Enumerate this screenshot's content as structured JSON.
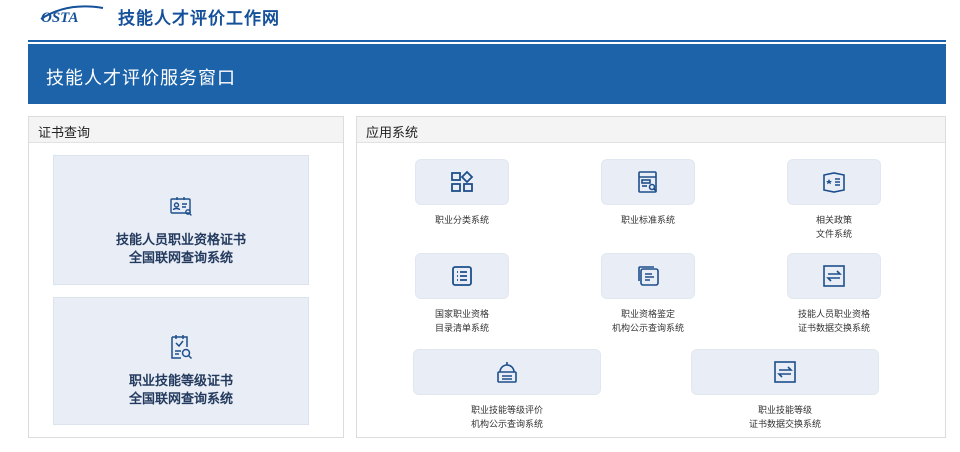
{
  "header": {
    "logo_text": "OSTA",
    "site_title": "技能人才评价工作网"
  },
  "banner": {
    "title": "技能人才评价服务窗口"
  },
  "cert_section": {
    "title": "证书查询",
    "cards": [
      {
        "line1": "技能人员职业资格证书",
        "line2": "全国联网查询系统",
        "icon": "id-card-search-icon"
      },
      {
        "line1": "职业技能等级证书",
        "line2": "全国联网查询系统",
        "icon": "document-search-icon"
      }
    ]
  },
  "app_section": {
    "title": "应用系统",
    "tiles": [
      {
        "line1": "职业分类系统",
        "line2": "",
        "icon": "category-grid-icon"
      },
      {
        "line1": "职业标准系统",
        "line2": "",
        "icon": "standard-search-icon"
      },
      {
        "line1": "相关政策",
        "line2": "文件系统",
        "icon": "policy-book-icon"
      },
      {
        "line1": "国家职业资格",
        "line2": "目录清单系统",
        "icon": "list-icon"
      },
      {
        "line1": "职业资格鉴定",
        "line2": "机构公示查询系统",
        "icon": "document-stack-icon"
      },
      {
        "line1": "技能人员职业资格",
        "line2": "证书数据交换系统",
        "icon": "exchange-icon"
      },
      {
        "line1": "职业技能等级评价",
        "line2": "机构公示查询系统",
        "icon": "institution-icon"
      },
      {
        "line1": "职业技能等级",
        "line2": "证书数据交换系统",
        "icon": "exchange-icon"
      }
    ]
  },
  "colors": {
    "brand_blue": "#1d63aa",
    "card_bg": "#e9eef6",
    "icon_blue": "#1d4f8c"
  }
}
